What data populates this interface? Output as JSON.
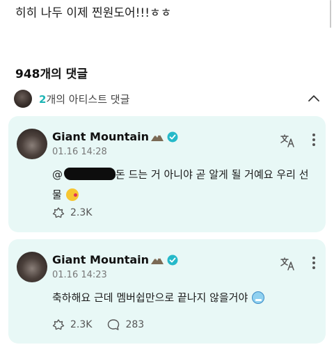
{
  "post": {
    "text": "히히 나두 이제 찐원도어!!!ㅎㅎ"
  },
  "comments_header": {
    "count_label": "948개의 댓글"
  },
  "artist_section": {
    "count": "2",
    "label_suffix": "개의 아티스트 댓글"
  },
  "comments": [
    {
      "author": "Giant Mountain",
      "timestamp": "01.16 14:28",
      "mention_prefix": "@",
      "body": "돈 드는 거 아니야 곧 알게 될 거예요 우리 선물",
      "likes": "2.3K"
    },
    {
      "author": "Giant Mountain",
      "timestamp": "01.16 14:23",
      "body": "축하해요 근데 멤버쉽만으로 끝나지 않을거야",
      "likes": "2.3K",
      "replies": "283"
    }
  ],
  "colors": {
    "accent": "#1fb5b5",
    "card_bg": "#e8f8f6",
    "verified": "#25b9c9"
  },
  "icons": [
    "chevron-up-icon",
    "mountain-icon",
    "verified-icon",
    "translate-icon",
    "more-icon",
    "like-icon",
    "reply-icon"
  ]
}
